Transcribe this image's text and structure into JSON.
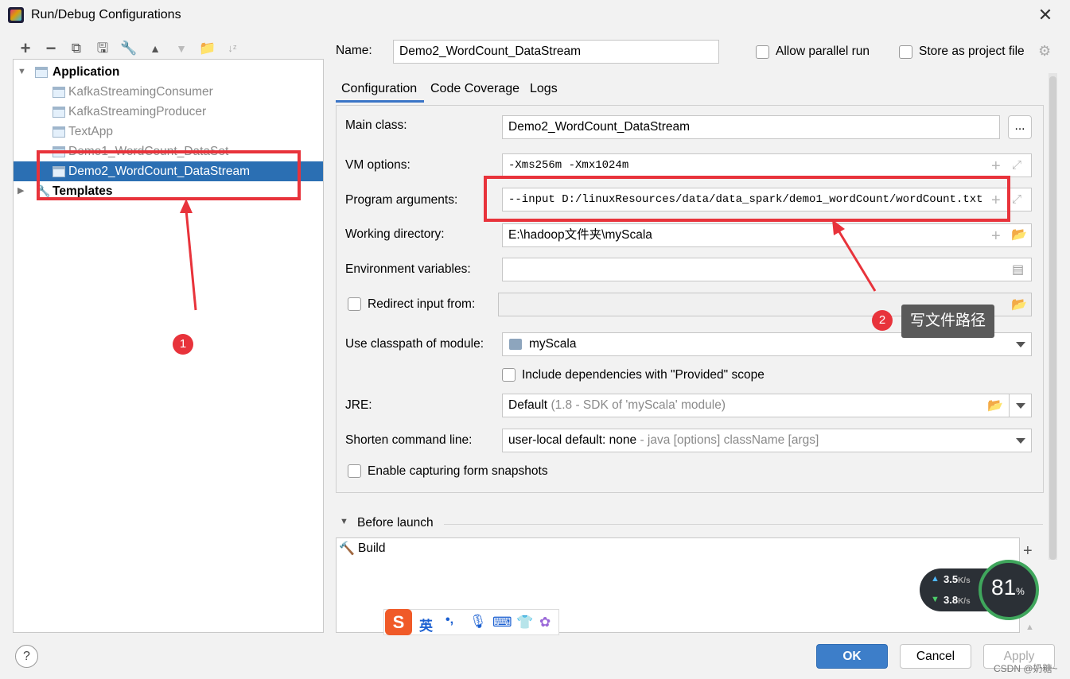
{
  "window": {
    "title": "Run/Debug Configurations"
  },
  "toolbar": {
    "icons": [
      "plus-icon",
      "minus-icon",
      "copy-icon",
      "save-icon",
      "wrench-icon",
      "arrow-up-icon",
      "arrow-down-icon",
      "folder-plus-icon",
      "sort-az-icon"
    ]
  },
  "tree": {
    "application_label": "Application",
    "items": [
      {
        "label": "KafkaStreamingConsumer"
      },
      {
        "label": "KafkaStreamingProducer"
      },
      {
        "label": "TextApp"
      },
      {
        "label": "Demo1_WordCount_DataSet"
      },
      {
        "label": "Demo2_WordCount_DataStream"
      }
    ],
    "templates_label": "Templates"
  },
  "header": {
    "name_label": "Name:",
    "name_value": "Demo2_WordCount_DataStream",
    "parallel_label": "Allow parallel run",
    "store_label": "Store as project file"
  },
  "tabs": [
    "Configuration",
    "Code Coverage",
    "Logs"
  ],
  "form": {
    "main_class_label": "Main class:",
    "main_class_value": "Demo2_WordCount_DataStream",
    "browse_label": "...",
    "vm_label": "VM options:",
    "vm_value": "-Xms256m -Xmx1024m",
    "args_label": "Program arguments:",
    "args_value": "--input D:/linuxResources/data/data_spark/demo1_wordCount/wordCount.txt",
    "workdir_label": "Working directory:",
    "workdir_value": "E:\\hadoop文件夹\\myScala",
    "env_label": "Environment variables:",
    "redirect_label": "Redirect input from:",
    "classpath_label": "Use classpath of module:",
    "classpath_value": "myScala",
    "include_deps_label": "Include dependencies with \"Provided\" scope",
    "jre_label": "JRE:",
    "jre_value": "Default",
    "jre_hint": "(1.8 - SDK of 'myScala' module)",
    "shorten_label": "Shorten command line:",
    "shorten_value": "user-local default: none",
    "shorten_hint": "- java [options] className [args]",
    "snapshots_label": "Enable capturing form snapshots"
  },
  "before_launch": {
    "title": "Before launch",
    "items": [
      "Build"
    ]
  },
  "annotations": {
    "badge1": "1",
    "badge2": "2",
    "tooltip": "写文件路径",
    "accent": "#e8333b"
  },
  "ime": {
    "lang": "英",
    "punct": "•,"
  },
  "netmon": {
    "up": "3.5",
    "down": "3.8",
    "unit": "K/s",
    "percent": "81",
    "percent_sign": "%"
  },
  "buttons": {
    "help": "?",
    "ok": "OK",
    "cancel": "Cancel",
    "apply": "Apply"
  },
  "watermark": "CSDN @奶糖~"
}
